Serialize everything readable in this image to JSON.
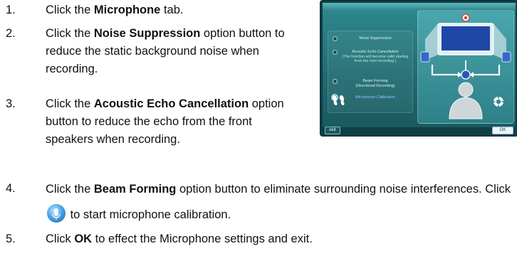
{
  "steps": [
    {
      "num": "1.",
      "pre": "Click the ",
      "bold": "Microphone",
      "post": " tab."
    },
    {
      "num": "2.",
      "pre": "Click the ",
      "bold": "Noise Suppression",
      "post": " option button to reduce the static background noise when recording."
    },
    {
      "num": "3.",
      "pre": "Click the ",
      "bold": "Acoustic Echo Cancellation",
      "post": " option button to reduce the echo from the front speakers when recording."
    },
    {
      "num": "4.",
      "pre": "Click the ",
      "bold": "Beam Forming",
      "post": " option button to eliminate surrounding noise interferences. Click ",
      "post2": " to start microphone calibration."
    },
    {
      "num": "5.",
      "pre": "Click ",
      "bold": "OK",
      "post": " to effect the Microphone settings and exit."
    }
  ],
  "screenshot": {
    "options": [
      {
        "label": "Noise Suppression"
      },
      {
        "label": "Acoustic Echo Cancellation",
        "note": "(The function will become valid starting from the next recording.)"
      },
      {
        "label": "Beam Forming",
        "note": "(Directional Recording)"
      },
      {
        "label": "Microphone Calibration"
      }
    ],
    "exit_label": "exit",
    "ok_label": "OK"
  },
  "icons": {
    "calibration": "microphone-calibration-icon",
    "ear": "ear-icon",
    "gear": "gear-icon"
  },
  "colors": {
    "panel_bg": "#0f3f45",
    "panel_accent": "#2f8a8f",
    "calibration_icon": "#4aa6e6"
  }
}
